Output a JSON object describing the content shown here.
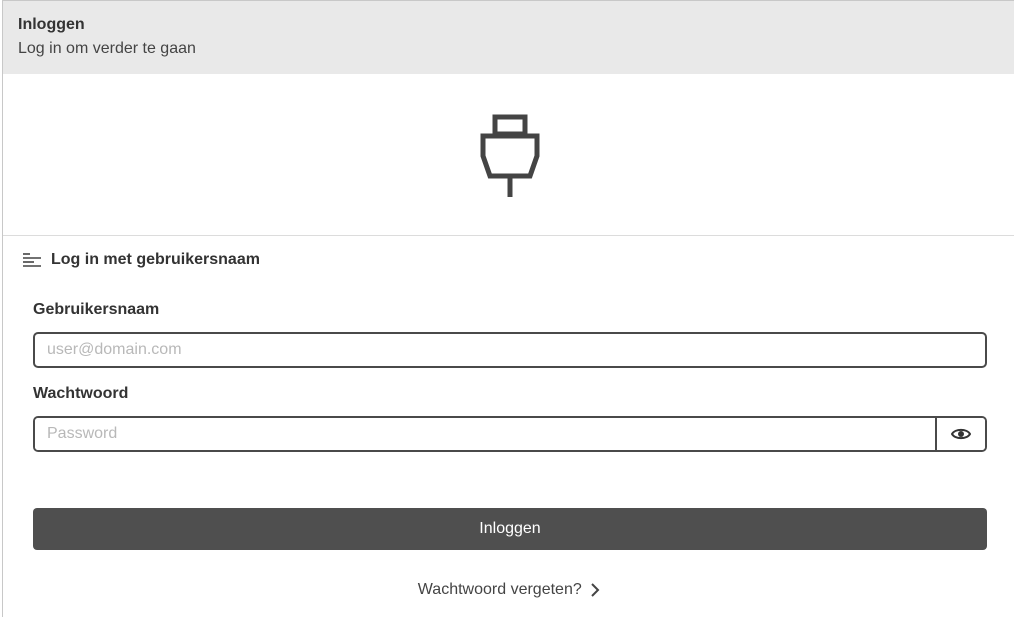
{
  "header": {
    "title": "Inloggen",
    "subtitle": "Log in om verder te gaan"
  },
  "logo": {
    "icon": "plug-icon"
  },
  "section": {
    "icon": "list-icon",
    "title": "Log in met gebruikersnaam"
  },
  "form": {
    "username_label": "Gebruikersnaam",
    "username_value": "",
    "username_placeholder": "user@domain.com",
    "password_label": "Wachtwoord",
    "password_value": "",
    "password_placeholder": "Password",
    "show_password_icon": "eye-icon",
    "submit_label": "Inloggen",
    "forgot_label": "Wachtwoord vergeten?",
    "forgot_icon": "chevron-right-icon"
  },
  "colors": {
    "header_bg": "#e9e9e9",
    "button_bg": "#4f4f4f",
    "border": "#4a4a4a"
  }
}
